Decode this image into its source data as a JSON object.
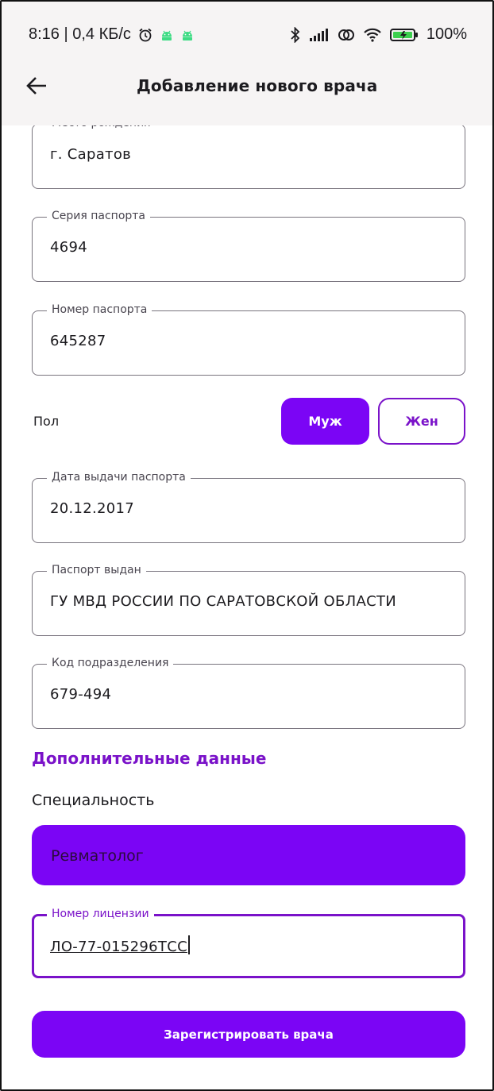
{
  "status_bar": {
    "time_speed": "8:16 | 0,4 КБ/с",
    "battery": "100%",
    "icons": [
      "alarm-icon",
      "android-icon",
      "android-icon",
      "bluetooth-icon",
      "signal-icon",
      "hotspot-icon",
      "wifi-icon",
      "battery-icon"
    ]
  },
  "app_bar": {
    "title": "Добавление нового врача",
    "back_icon": "arrow-back-icon"
  },
  "form": {
    "birthplace": {
      "label": "Место рождения",
      "value": "г. Саратов"
    },
    "passport_series": {
      "label": "Серия паспорта",
      "value": "4694"
    },
    "passport_number": {
      "label": "Номер паспорта",
      "value": "645287"
    },
    "gender": {
      "label": "Пол",
      "options": [
        "Муж",
        "Жен"
      ],
      "selected": "Муж"
    },
    "passport_issue_date": {
      "label": "Дата выдачи паспорта",
      "value": "20.12.2017"
    },
    "passport_issued_by": {
      "label": "Паспорт выдан",
      "value": "ГУ МВД РОССИИ ПО САРАТОВСКОЙ ОБЛАСТИ"
    },
    "department_code": {
      "label": "Код подразделения",
      "value": "679-494"
    }
  },
  "additional": {
    "section_title": "Дополнительные данные",
    "specialty_label": "Специальность",
    "specialty_value": "Ревматолог",
    "license": {
      "label": "Номер лицензии",
      "value": "ЛО-77-015296ТСС"
    }
  },
  "submit_label": "Зарегистрировать врача",
  "colors": {
    "accent": "#7b05f5",
    "accent_text": "#7a12c9",
    "top_bar_bg": "#f6f4f4",
    "outline": "#79747e"
  }
}
